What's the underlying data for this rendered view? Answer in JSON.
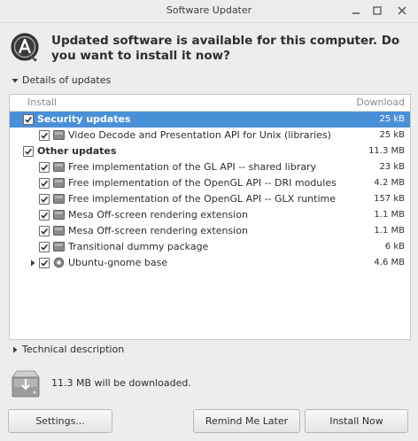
{
  "window": {
    "title": "Software Updater"
  },
  "header": {
    "message": "Updated software is available for this computer. Do you want to install it now?",
    "icon": "software-updater-icon"
  },
  "details_expander": {
    "label": "Details of updates",
    "expanded": true
  },
  "tree": {
    "col_install": "Install",
    "col_download": "Download",
    "rows": [
      {
        "kind": "group",
        "label": "Security updates",
        "size": "25 kB",
        "checked": true,
        "selected": true
      },
      {
        "kind": "item",
        "label": "Video Decode and Presentation API for Unix (libraries)",
        "size": "25 kB",
        "checked": true,
        "icon": "package-icon"
      },
      {
        "kind": "group",
        "label": "Other updates",
        "size": "11.3 MB",
        "checked": true,
        "selected": false
      },
      {
        "kind": "item",
        "label": "Free implementation of the GL API -- shared library",
        "size": "23 kB",
        "checked": true,
        "icon": "package-icon"
      },
      {
        "kind": "item",
        "label": "Free implementation of the OpenGL API -- DRI modules",
        "size": "4.2 MB",
        "checked": true,
        "icon": "package-icon"
      },
      {
        "kind": "item",
        "label": "Free implementation of the OpenGL API -- GLX runtime",
        "size": "157 kB",
        "checked": true,
        "icon": "package-icon"
      },
      {
        "kind": "item",
        "label": "Mesa Off-screen rendering extension",
        "size": "1.1 MB",
        "checked": true,
        "icon": "package-icon"
      },
      {
        "kind": "item",
        "label": "Mesa Off-screen rendering extension",
        "size": "1.1 MB",
        "checked": true,
        "icon": "package-icon"
      },
      {
        "kind": "item",
        "label": "Transitional dummy package",
        "size": "6 kB",
        "checked": true,
        "icon": "package-icon"
      },
      {
        "kind": "item",
        "label": "Ubuntu-gnome base",
        "size": "4.6 MB",
        "checked": true,
        "icon": "gear-icon",
        "expandable": true
      }
    ]
  },
  "technical_expander": {
    "label": "Technical description",
    "expanded": false
  },
  "footer": {
    "download_text": "11.3 MB will be downloaded.",
    "icon": "disk-icon"
  },
  "buttons": {
    "settings": "Settings...",
    "remind": "Remind Me Later",
    "install": "Install Now"
  },
  "colors": {
    "selection": "#4a90d9",
    "window_bg": "#ededec"
  }
}
